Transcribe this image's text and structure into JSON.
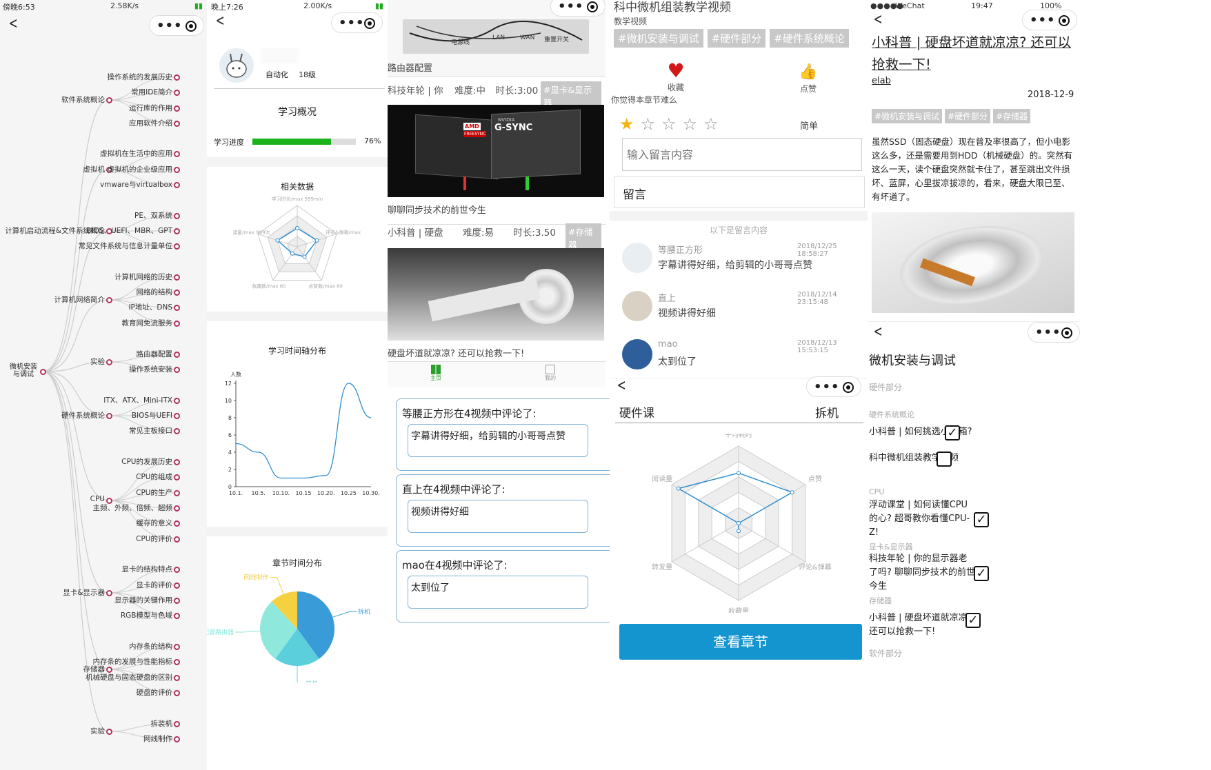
{
  "p1": {
    "status": {
      "time": "傍晚6:53",
      "speed": "2.58K/s"
    },
    "root": "微机安装\n与调试",
    "branches": [
      {
        "label": "软件系统概论",
        "y": 145,
        "leaves": [
          [
            "操作系统的发展历史",
            112
          ],
          [
            "常用IDE简介",
            134
          ],
          [
            "运行库的作用",
            157
          ],
          [
            "应用软件介绍",
            179
          ]
        ]
      },
      {
        "label": "虚拟机",
        "y": 246,
        "leaves": [
          [
            "虚拟机在生活中的应用",
            223
          ],
          [
            "虚拟机的企业级应用",
            246
          ],
          [
            "vmware与virtualbox",
            268
          ]
        ]
      },
      {
        "label": "计算机启动流程&文件系统概论",
        "y": 335,
        "leaves": [
          [
            "PE、双系统",
            313
          ],
          [
            "BIOS、UEFI、MBR、GPT",
            335
          ],
          [
            "常见文件系统与信息计量单位",
            357
          ]
        ]
      },
      {
        "label": "计算机网络简介",
        "y": 435,
        "leaves": [
          [
            "计算机网络的历史",
            402
          ],
          [
            "网络的结构",
            424
          ],
          [
            "IP地址、DNS",
            446
          ],
          [
            "教育网免流服务",
            469
          ]
        ]
      },
      {
        "label": "实验",
        "y": 525,
        "leaves": [
          [
            "路由器配置",
            514
          ],
          [
            "操作系统安装",
            536
          ]
        ]
      },
      {
        "label": "硬件系统概论",
        "y": 603,
        "leaves": [
          [
            "ITX、ATX、Mini-ITX",
            581
          ],
          [
            "BIOS与UEFI",
            603
          ],
          [
            "常见主板接口",
            625
          ]
        ]
      },
      {
        "label": "CPU",
        "y": 726,
        "leaves": [
          [
            "CPU的发展历史",
            670
          ],
          [
            "CPU的组成",
            692
          ],
          [
            "CPU的生产",
            715
          ],
          [
            "主频、外频、倍频、超频",
            737
          ],
          [
            "缓存的意义",
            759
          ],
          [
            "CPU的评价",
            782
          ]
        ]
      },
      {
        "label": "显卡&显示器",
        "y": 860,
        "leaves": [
          [
            "显卡的结构特点",
            826
          ],
          [
            "显卡的评价",
            849
          ],
          [
            "显示器的关键作用",
            871
          ],
          [
            "RGB模型与色域",
            893
          ]
        ]
      },
      {
        "label": "存储器",
        "y": 971,
        "leaves": [
          [
            "内存条的结构",
            938
          ],
          [
            "内存条的发展与性能指标",
            960
          ],
          [
            "机械硬盘与固态硬盘的区别",
            983
          ],
          [
            "硬盘的评价",
            1005
          ]
        ]
      },
      {
        "label": "实验",
        "y": 1061,
        "leaves": [
          [
            "拆装机",
            1050
          ],
          [
            "网线制作",
            1072
          ]
        ]
      }
    ]
  },
  "p2": {
    "status": {
      "time": "晚上7:26",
      "speed": "2.00K/s"
    },
    "user": {
      "org": "自动化",
      "grade": "18级"
    },
    "title": "学习概况",
    "progress": {
      "label": "学习进度",
      "value": 76,
      "text": "76%"
    },
    "radar": {
      "title": "相关数据",
      "axes": [
        "学习时长/max 999min",
        "评论&弹幕/max",
        "点赞数/max 60",
        "收藏数/max 60",
        "读量/max 999次"
      ],
      "values": [
        0.45,
        0.5,
        0.3,
        0.2,
        0.5
      ]
    },
    "line": {
      "title": "学习时间轴分布",
      "ylabel": "人数",
      "x": [
        "10.1.",
        "10.5.",
        "10.10.",
        "10.15",
        "10.20.",
        "10.25",
        "10.30."
      ],
      "yticks": [
        "0",
        "2",
        "4",
        "6",
        "8",
        "10",
        "12"
      ],
      "values": [
        5,
        4,
        1,
        1,
        1.3,
        12,
        8
      ]
    },
    "pie": {
      "title": "章节时间分布",
      "slices": [
        {
          "name": "拆机",
          "value": 40,
          "color": "#3a9bd9"
        },
        {
          "name": "装机",
          "value": 20,
          "color": "#5bd0dc"
        },
        {
          "name": "配置路由器",
          "value": 28,
          "color": "#8ee8dc"
        },
        {
          "name": "网线制作",
          "value": 12,
          "color": "#f5d142"
        }
      ]
    }
  },
  "p3": {
    "card1": {
      "caption": "路由器配置",
      "img_labels": [
        "电源线",
        "LAN",
        "WAN",
        "重置开关"
      ]
    },
    "meta1": {
      "author": "科技年轮 | 你",
      "difficulty": "难度:中",
      "duration": "时长:3:00",
      "tag": "#显卡&显示器"
    },
    "card2": {
      "caption": "聊聊同步技术的前世今生",
      "badges": [
        "AMD",
        "NVIDIA",
        "G-SYNC",
        "FREESYNC"
      ]
    },
    "meta2": {
      "author": "小科普 | 硬盘",
      "difficulty": "难度:易",
      "duration": "时长:3.50",
      "tag": "#存储器"
    },
    "card3": {
      "caption": "硬盘坏道就凉凉? 还可以抢救一下!"
    },
    "tabs": [
      "主页",
      "我的"
    ],
    "comments": [
      {
        "title": "等腰正方形在4视频中评论了:",
        "text": "字幕讲得好细，给剪辑的小哥哥点赞"
      },
      {
        "title": "直上在4视频中评论了:",
        "text": "视频讲得好细"
      },
      {
        "title": "mao在4视频中评论了:",
        "text": "太到位了"
      }
    ]
  },
  "p4": {
    "title": "科中微机组装教学视频",
    "sub": "教学视频",
    "tags": [
      "#微机安装与调试",
      "#硬件部分",
      "#硬件系统概论"
    ],
    "fav": "收藏",
    "like": "点赞",
    "question": "你觉得本章节难么",
    "difficulty": "简单",
    "placeholder": "输入留言内容",
    "leave": "留言",
    "divider": "以下是留言内容",
    "comments": [
      {
        "name": "等腰正方形",
        "time": "2018/12/25 18:58:27",
        "text": "字幕讲得好细，给剪辑的小哥哥点赞"
      },
      {
        "name": "直上",
        "time": "2018/12/14 23:15:48",
        "text": "视频讲得好细"
      },
      {
        "name": "mao",
        "time": "2018/12/13 15:53:15",
        "text": "太到位了"
      }
    ],
    "course": "硬件课",
    "chapter": "拆机",
    "radar": {
      "axes": [
        "平均耗时",
        "点赞",
        "评论&弹幕",
        "收藏量",
        "转发量",
        "阅读量"
      ],
      "values": [
        0.65,
        0.8,
        0.0,
        0.1,
        0.0,
        0.9
      ]
    },
    "button": "查看章节"
  },
  "p5": {
    "status": {
      "carrier": "WeChat",
      "time": "19:47",
      "battery": "100%"
    },
    "article": {
      "title": "小科普 | 硬盘坏道就凉凉? 还可以抢救一下!",
      "author": "elab",
      "date": "2018-12-9",
      "tags": [
        "#微机安装与调试",
        "#硬件部分",
        "#存储器"
      ],
      "body": "虽然SSD（固态硬盘）现在普及率很高了，但小电影这么多，还是需要用到HDD（机械硬盘）的。突然有这么一天，读个硬盘突然就卡住了，甚至跳出文件损坏、蓝屏，心里拔凉拔凉的，看来，硬盘大限已至、有坏道了。"
    },
    "list": {
      "title": "微机安装与调试",
      "sec": "硬件部分",
      "groups": [
        {
          "label": "硬件系统概论",
          "items": [
            {
              "text": "小科普 | 如何挑选小机箱?",
              "checked": true
            },
            {
              "text": "科中微机组装教学视频",
              "checked": false
            }
          ]
        },
        {
          "label": "CPU",
          "items": [
            {
              "text": "浮动课堂 | 如何读懂CPU的心? 超哥教你看懂CPU-Z!",
              "checked": true
            }
          ]
        },
        {
          "label": "显卡&显示器",
          "items": [
            {
              "text": "科技年轮 | 你的显示器老了吗? 聊聊同步技术的前世今生",
              "checked": true
            }
          ]
        },
        {
          "label": "存储器",
          "items": [
            {
              "text": "小科普 | 硬盘坏道就凉凉? 还可以抢救一下!",
              "checked": true
            }
          ]
        }
      ],
      "footer": "软件部分"
    }
  }
}
